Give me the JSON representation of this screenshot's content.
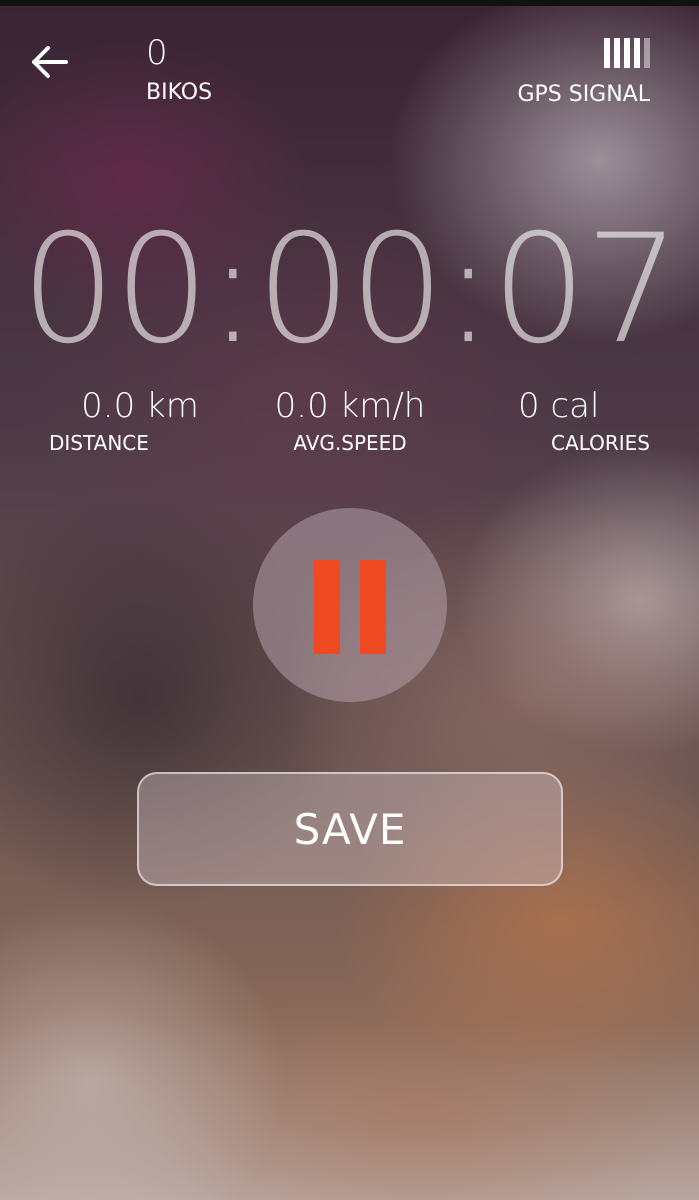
{
  "header": {
    "bikos_count": "0",
    "bikos_label": "BIKOS",
    "gps_label": "GPS SIGNAL",
    "gps_level": "4 of 5"
  },
  "timer": {
    "value": "00:00:07"
  },
  "stats": {
    "distance_value": "0.0 km",
    "distance_label": "DISTANCE",
    "speed_value": "0.0 km/h",
    "speed_label": "AVG.SPEED",
    "calories_value": "0 cal",
    "calories_label": "CALORIES"
  },
  "actions": {
    "save_label": "SAVE"
  },
  "colors": {
    "accent": "#ef4a23"
  },
  "icons": {
    "back": "arrow-left-icon",
    "pause": "pause-icon",
    "gps": "signal-bars-icon"
  }
}
